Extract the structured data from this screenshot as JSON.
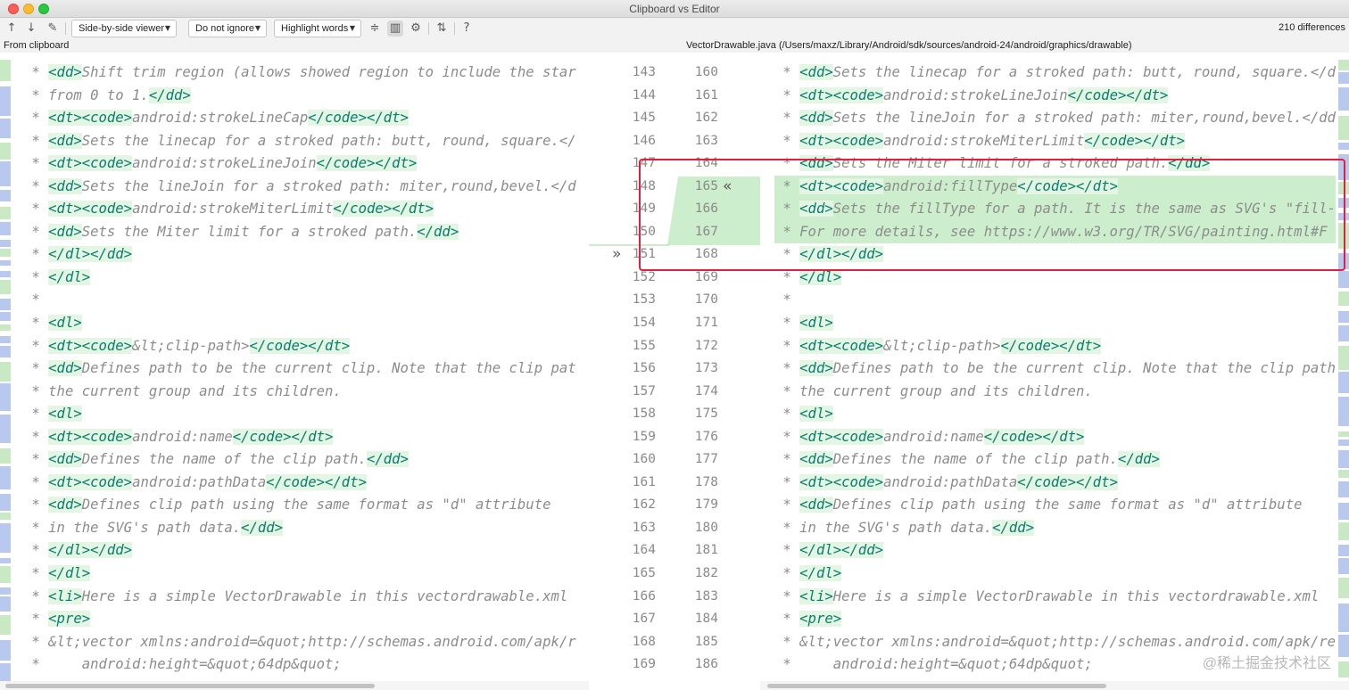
{
  "window": {
    "title": "Clipboard vs Editor"
  },
  "toolbar": {
    "viewer_label": "Side-by-side viewer",
    "ignore_label": "Do not ignore",
    "highlight_label": "Highlight words",
    "help_label": "?",
    "differences": "210 differences"
  },
  "paths": {
    "left": "From clipboard",
    "right": "VectorDrawable.java (/Users/maxz/Library/Android/sdk/sources/android-24/android/graphics/drawable)"
  },
  "left_lines": [
    " * <dd>Shift trim region (allows showed region to include the star",
    " * from 0 to 1.</dd>",
    " * <dt><code>android:strokeLineCap</code></dt>",
    " * <dd>Sets the linecap for a stroked path: butt, round, square.</",
    " * <dt><code>android:strokeLineJoin</code></dt>",
    " * <dd>Sets the lineJoin for a stroked path: miter,round,bevel.</d",
    " * <dt><code>android:strokeMiterLimit</code></dt>",
    " * <dd>Sets the Miter limit for a stroked path.</dd>",
    " * </dl></dd>",
    " * </dl>",
    " *",
    " * <dl>",
    " * <dt><code>&lt;clip-path></code></dt>",
    " * <dd>Defines path to be the current clip. Note that the clip pat",
    " * the current group and its children.",
    " * <dl>",
    " * <dt><code>android:name</code></dt>",
    " * <dd>Defines the name of the clip path.</dd>",
    " * <dt><code>android:pathData</code></dt>",
    " * <dd>Defines clip path using the same format as \"d\" attribute",
    " * in the SVG's path data.</dd>",
    " * </dl></dd>",
    " * </dl>",
    " * <li>Here is a simple VectorDrawable in this vectordrawable.xml ",
    " * <pre>",
    " * &lt;vector xmlns:android=&quot;http://schemas.android.com/apk/r",
    " *     android:height=&quot;64dp&quot;"
  ],
  "right_lines": [
    " * <dd>Sets the linecap for a stroked path: butt, round, square.</d",
    " * <dt><code>android:strokeLineJoin</code></dt>",
    " * <dd>Sets the lineJoin for a stroked path: miter,round,bevel.</dd",
    " * <dt><code>android:strokeMiterLimit</code></dt>",
    " * <dd>Sets the Miter limit for a stroked path.</dd>",
    " * <dt><code>android:fillType</code></dt>",
    " * <dd>Sets the fillType for a path. It is the same as SVG's \"fill-",
    " * For more details, see https://www.w3.org/TR/SVG/painting.html#F",
    " * </dl></dd>",
    " * </dl>",
    " *",
    " * <dl>",
    " * <dt><code>&lt;clip-path></code></dt>",
    " * <dd>Defines path to be the current clip. Note that the clip path",
    " * the current group and its children.",
    " * <dl>",
    " * <dt><code>android:name</code></dt>",
    " * <dd>Defines the name of the clip path.</dd>",
    " * <dt><code>android:pathData</code></dt>",
    " * <dd>Defines clip path using the same format as \"d\" attribute",
    " * in the SVG's path data.</dd>",
    " * </dl></dd>",
    " * </dl>",
    " * <li>Here is a simple VectorDrawable in this vectordrawable.xml ",
    " * <pre>",
    " * &lt;vector xmlns:android=&quot;http://schemas.android.com/apk/re",
    " *     android:height=&quot;64dp&quot;"
  ],
  "left_numbers": [
    "143",
    "144",
    "145",
    "146",
    "147",
    "148",
    "149",
    "150",
    "151",
    "152",
    "153",
    "154",
    "155",
    "156",
    "157",
    "158",
    "159",
    "160",
    "161",
    "162",
    "163",
    "164",
    "165",
    "166",
    "167",
    "168",
    "169"
  ],
  "right_numbers": [
    "160",
    "161",
    "162",
    "163",
    "164",
    "165",
    "166",
    "167",
    "168",
    "169",
    "170",
    "171",
    "172",
    "173",
    "174",
    "175",
    "176",
    "177",
    "178",
    "179",
    "180",
    "181",
    "182",
    "183",
    "184",
    "185",
    "186"
  ],
  "highlighted_right_rows": [
    5,
    6,
    7
  ],
  "watermark": "@稀土掘金技术社区"
}
